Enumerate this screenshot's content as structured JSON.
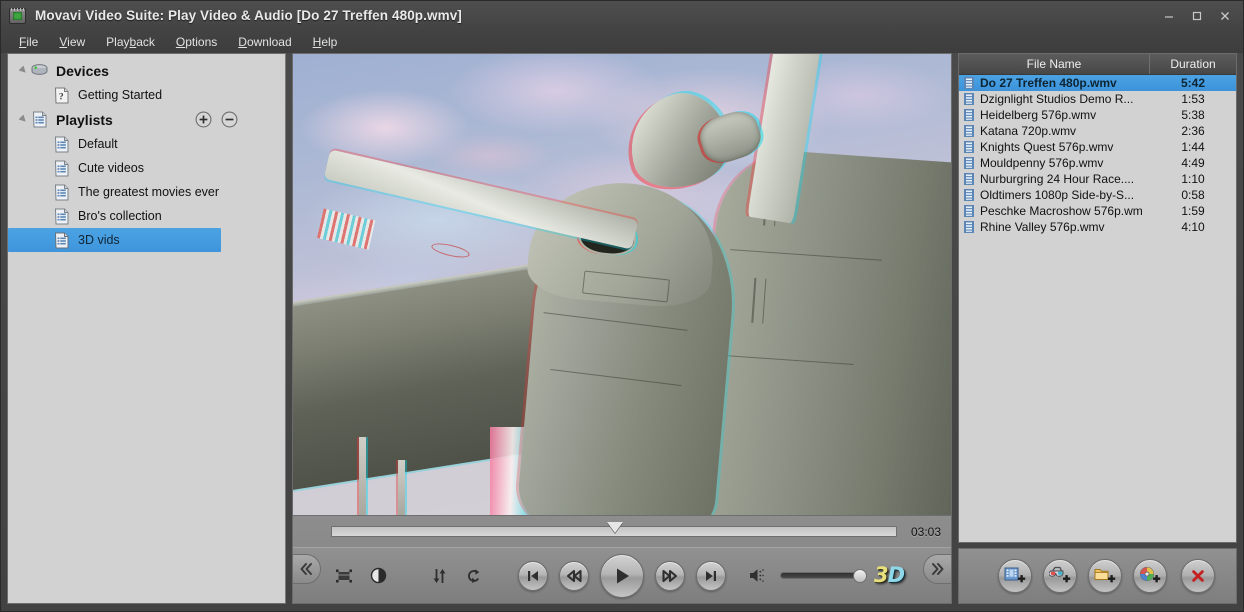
{
  "window": {
    "title": "Movavi Video Suite: Play Video & Audio [Do 27 Treffen 480p.wmv]",
    "app_icon": "movavi-app-icon",
    "minimize": "minimize-icon",
    "maximize": "maximize-icon",
    "close": "close-icon"
  },
  "menubar": {
    "items": [
      {
        "label": "File",
        "accel": "F"
      },
      {
        "label": "View",
        "accel": "V"
      },
      {
        "label": "Playback",
        "accel": "b"
      },
      {
        "label": "Options",
        "accel": "O"
      },
      {
        "label": "Download",
        "accel": "D"
      },
      {
        "label": "Help",
        "accel": "H"
      }
    ]
  },
  "sidebar": {
    "groups": [
      {
        "label": "Devices",
        "icon": "device-drive-icon",
        "expanded": true,
        "children": [
          {
            "label": "Getting Started",
            "icon": "question-help-icon",
            "selected": false
          }
        ]
      },
      {
        "label": "Playlists",
        "icon": "playlist-icon",
        "expanded": true,
        "add_button": "add-playlist-button",
        "remove_button": "remove-playlist-button",
        "children": [
          {
            "label": "Default",
            "icon": "playlist-icon",
            "selected": false
          },
          {
            "label": "Cute videos",
            "icon": "playlist-icon",
            "selected": false
          },
          {
            "label": "The greatest movies ever",
            "icon": "playlist-icon",
            "selected": false
          },
          {
            "label": "Bro's collection",
            "icon": "playlist-icon",
            "selected": false
          },
          {
            "label": "3D vids",
            "icon": "playlist-icon",
            "selected": true
          }
        ]
      }
    ]
  },
  "player": {
    "video_description": "Anaglyph 3D still of a vintage Dornier Do 27 aircraft propeller, engine nacelle and wing against a cloudy sky",
    "seek": {
      "position_percent": 50,
      "time": "03:03"
    },
    "collapse_left": "collapse-left-button",
    "collapse_right": "collapse-right-button",
    "tools": [
      {
        "name": "aspect-ratio-button",
        "icon": "crop-frame-icon"
      },
      {
        "name": "adjustments-button",
        "icon": "contrast-circle-icon"
      },
      {
        "name": "audio-track-button",
        "icon": "up-down-arrows-icon"
      },
      {
        "name": "repeat-button",
        "icon": "loop-repeat-icon"
      }
    ],
    "transport": [
      {
        "name": "previous-button",
        "icon": "skip-previous-icon"
      },
      {
        "name": "rewind-button",
        "icon": "rewind-icon"
      },
      {
        "name": "play-button",
        "icon": "play-icon"
      },
      {
        "name": "fast-forward-button",
        "icon": "fast-forward-icon"
      },
      {
        "name": "next-button",
        "icon": "skip-next-icon"
      }
    ],
    "volume": {
      "icon": "speaker-icon",
      "level_percent": 100
    },
    "stereo_logo": {
      "part1": "3",
      "part2": "D"
    }
  },
  "playlist": {
    "columns": [
      {
        "key": "name",
        "label": "File Name"
      },
      {
        "key": "duration",
        "label": "Duration"
      }
    ],
    "rows": [
      {
        "name": "Do 27 Treffen 480p.wmv",
        "duration": "5:42",
        "selected": true
      },
      {
        "name": "Dzignlight Studios Demo R...",
        "duration": "1:53",
        "selected": false
      },
      {
        "name": "Heidelberg 576p.wmv",
        "duration": "5:38",
        "selected": false
      },
      {
        "name": "Katana 720p.wmv",
        "duration": "2:36",
        "selected": false
      },
      {
        "name": "Knights Quest 576p.wmv",
        "duration": "1:44",
        "selected": false
      },
      {
        "name": "Mouldpenny 576p.wmv",
        "duration": "4:49",
        "selected": false
      },
      {
        "name": "Nurburgring 24 Hour Race....",
        "duration": "1:10",
        "selected": false
      },
      {
        "name": "Oldtimers 1080p Side-by-S...",
        "duration": "0:58",
        "selected": false
      },
      {
        "name": "Peschke Macroshow 576p.wm",
        "duration": "1:59",
        "selected": false
      },
      {
        "name": "Rhine Valley 576p.wmv",
        "duration": "4:10",
        "selected": false
      }
    ],
    "toolbar": [
      {
        "name": "add-video-button",
        "icon": "add-film-icon"
      },
      {
        "name": "add-3d-video-button",
        "icon": "add-3d-glasses-icon"
      },
      {
        "name": "add-folder-button",
        "icon": "add-folder-icon"
      },
      {
        "name": "add-disc-button",
        "icon": "add-disc-icon"
      },
      {
        "name": "remove-file-button",
        "icon": "red-x-icon"
      }
    ]
  },
  "colors": {
    "accent_selection": "#4ba3e3",
    "chrome_dark": "#434343",
    "panel_light": "#d2d2d2",
    "control_gray": "#8a8a8a",
    "delete_red": "#cc2222",
    "logo_yellow": "#e8e07a",
    "logo_cyan": "#8fd8ea"
  }
}
